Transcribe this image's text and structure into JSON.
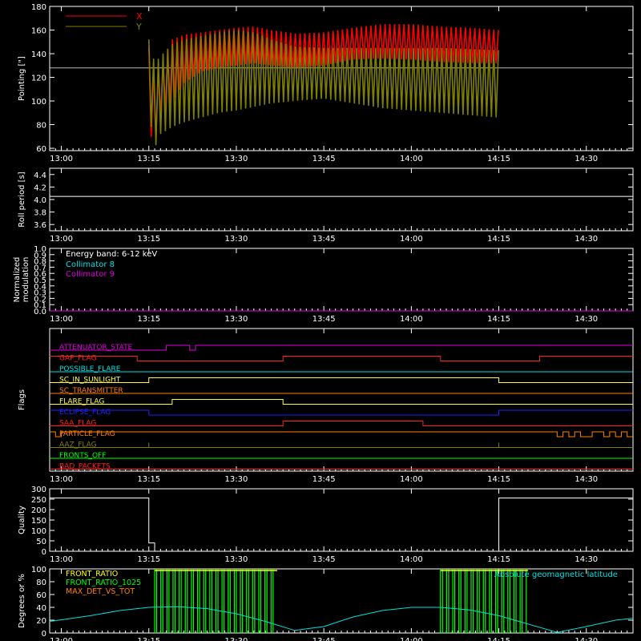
{
  "time_ticks": [
    "13:00",
    "13:15",
    "13:30",
    "13:45",
    "14:00",
    "14:15",
    "14:30"
  ],
  "chart_data": [
    {
      "type": "line",
      "ylabel": "Pointing [\"]",
      "ylim": [
        58,
        180
      ],
      "yticks": [
        60,
        80,
        100,
        120,
        140,
        160,
        180
      ],
      "x_axis": "time of day",
      "xlim": [
        "12:58",
        "14:38"
      ],
      "reference_line": 128,
      "legend_position": "top-left",
      "series": [
        {
          "name": "X",
          "color": "#ff0000",
          "x": [
            "13:15",
            "13:16",
            "13:17",
            "13:19",
            "13:21",
            "13:24",
            "13:27",
            "13:30",
            "13:33",
            "13:36",
            "13:40",
            "13:45",
            "13:50",
            "13:55",
            "14:00",
            "14:05",
            "14:10",
            "14:15"
          ],
          "y_max": [
            145,
            122,
            128,
            152,
            156,
            158,
            160,
            162,
            163,
            160,
            157,
            158,
            162,
            165,
            165,
            163,
            162,
            160
          ],
          "y_min": [
            75,
            62,
            88,
            100,
            115,
            125,
            128,
            130,
            132,
            130,
            128,
            130,
            135,
            136,
            135,
            133,
            132,
            132
          ]
        },
        {
          "name": "Y",
          "color": "#808000",
          "x": [
            "13:15",
            "13:16",
            "13:17",
            "13:19",
            "13:21",
            "13:24",
            "13:27",
            "13:30",
            "13:33",
            "13:36",
            "13:40",
            "13:45",
            "13:50",
            "13:55",
            "14:00",
            "14:05",
            "14:10",
            "14:15"
          ],
          "y_max": [
            152,
            132,
            138,
            148,
            152,
            155,
            158,
            160,
            158,
            152,
            146,
            145,
            145,
            145,
            145,
            145,
            144,
            143
          ],
          "y_min": [
            90,
            60,
            72,
            78,
            82,
            86,
            90,
            92,
            95,
            98,
            100,
            102,
            98,
            94,
            92,
            90,
            88,
            86
          ]
        }
      ]
    },
    {
      "type": "line",
      "ylabel": "Roll period [s]",
      "ylim": [
        3.5,
        4.5
      ],
      "yticks": [
        3.6,
        3.8,
        4.0,
        4.2,
        4.4
      ],
      "series": [
        {
          "x": [
            "12:58",
            "14:38"
          ],
          "y": [
            4.05,
            4.05
          ],
          "color": "#ffffff"
        }
      ]
    },
    {
      "type": "line",
      "ylabel": "Normalized modulation",
      "ylim": [
        0,
        1.0
      ],
      "yticks": [
        0.0,
        0.1,
        0.2,
        0.3,
        0.4,
        0.5,
        0.6,
        0.7,
        0.8,
        0.9,
        1.0
      ],
      "annotation": "Energy band: 6-12 keV",
      "series": [
        {
          "name": "Collimator 8",
          "color": "#00e0e0",
          "x": [
            "12:58",
            "14:38"
          ],
          "y": [
            0,
            0
          ]
        },
        {
          "name": "Collimator 9",
          "color": "#e000e0",
          "x": [
            "12:58",
            "14:38"
          ],
          "y": [
            0,
            0
          ]
        }
      ]
    },
    {
      "type": "line",
      "ylabel": "Flags",
      "flags": [
        {
          "name": "ATTENUATOR_STATE",
          "color": "#e000e0",
          "x": [
            "12:58",
            "13:18",
            "13:18",
            "13:22",
            "13:22",
            "13:23",
            "13:23",
            "14:38"
          ],
          "y": [
            0,
            0,
            1,
            1,
            0,
            0,
            1,
            1
          ]
        },
        {
          "name": "GAP_FLAG",
          "color": "#ff2020",
          "x": [
            "12:58",
            "13:13",
            "13:13",
            "13:38",
            "13:38",
            "14:05",
            "14:05",
            "14:22",
            "14:22",
            "14:38"
          ],
          "y": [
            1,
            1,
            0,
            0,
            1,
            1,
            0,
            0,
            1,
            1
          ]
        },
        {
          "name": "POSSIBLE_FLARE",
          "color": "#00e0e0",
          "x": [
            "12:58",
            "14:38"
          ],
          "y": [
            0,
            0
          ]
        },
        {
          "name": "SC_IN_SUNLIGHT",
          "color": "#ffff40",
          "x": [
            "12:58",
            "13:15",
            "13:15",
            "14:15",
            "14:15",
            "14:38"
          ],
          "y": [
            0,
            0,
            1,
            1,
            0,
            0
          ]
        },
        {
          "name": "SC_TRANSMITTER",
          "color": "#ff8000",
          "x": [
            "12:58",
            "14:38"
          ],
          "y": [
            0,
            0
          ]
        },
        {
          "name": "FLARE_FLAG",
          "color": "#ffff40",
          "x": [
            "12:58",
            "13:19",
            "13:19",
            "13:38",
            "13:38",
            "14:38"
          ],
          "y": [
            0,
            0,
            1,
            1,
            0,
            0
          ]
        },
        {
          "name": "ECLIPSE_FLAG",
          "color": "#2020ff",
          "x": [
            "12:58",
            "13:15",
            "13:15",
            "14:15",
            "14:15",
            "14:38"
          ],
          "y": [
            1,
            1,
            0,
            0,
            1,
            1
          ]
        },
        {
          "name": "SAA_FLAG",
          "color": "#ff2020",
          "x": [
            "12:58",
            "13:38",
            "13:38",
            "14:02",
            "14:02",
            "14:38"
          ],
          "y": [
            0,
            0,
            1,
            1,
            0,
            0
          ]
        },
        {
          "name": "PARTICLE_FLAG",
          "color": "#ff8000",
          "x": [
            "12:58",
            "12:59",
            "12:59",
            "13:00",
            "13:00",
            "14:25",
            "14:25",
            "14:26",
            "14:26",
            "14:27",
            "14:27",
            "14:28",
            "14:28",
            "14:29",
            "14:29",
            "14:31",
            "14:31",
            "14:33",
            "14:33",
            "14:34",
            "14:34",
            "14:35",
            "14:35",
            "14:36",
            "14:36",
            "14:37",
            "14:37",
            "14:38"
          ],
          "y": [
            1,
            1,
            0,
            0,
            1,
            1,
            0,
            0,
            1,
            1,
            0,
            0,
            1,
            1,
            0,
            0,
            1,
            1,
            0,
            0,
            1,
            1,
            0,
            0,
            1,
            1,
            0,
            0
          ]
        },
        {
          "name": "AAZ_FLAG",
          "color": "#808000",
          "x": [
            "12:58",
            "13:15",
            "13:15",
            "13:15",
            "13:15",
            "14:15",
            "14:15",
            "14:15",
            "14:15",
            "14:38"
          ],
          "y": [
            0,
            0,
            1,
            1,
            0,
            0,
            1,
            1,
            0,
            0
          ]
        },
        {
          "name": "FRONTS_OFF",
          "color": "#00ff00",
          "x": [
            "12:58",
            "14:38"
          ],
          "y": [
            0,
            0
          ]
        },
        {
          "name": "BAD_PACKETS",
          "color": "#ff2020",
          "x": [
            "12:58",
            "14:38"
          ],
          "y": [
            0,
            0
          ]
        }
      ]
    },
    {
      "type": "line",
      "ylabel": "Quality",
      "ylim": [
        0,
        300
      ],
      "yticks": [
        0,
        50,
        100,
        150,
        200,
        250,
        300
      ],
      "series": [
        {
          "color": "#ffffff",
          "x": [
            "12:58",
            "13:15",
            "13:15",
            "13:16",
            "13:16",
            "13:30",
            "13:30",
            "13:30",
            "13:30",
            "14:15",
            "14:15",
            "14:38"
          ],
          "y": [
            256,
            256,
            40,
            40,
            0,
            0,
            8,
            8,
            0,
            0,
            256,
            256
          ]
        }
      ]
    },
    {
      "type": "line",
      "ylabel": "Degrees or %",
      "ylim": [
        0,
        100
      ],
      "yticks": [
        0,
        20,
        40,
        60,
        80,
        100
      ],
      "series": [
        {
          "name": "FRONT_RATIO",
          "color": "#ffff00",
          "x": [
            "12:58",
            "14:38"
          ],
          "y": [
            0,
            0
          ]
        },
        {
          "name": "FRONT_RATIO_1025",
          "color": "#00ff00",
          "x": [
            "12:58",
            "14:38"
          ],
          "y": [
            0,
            0
          ]
        },
        {
          "name": "MAX_DET_VS_TOT",
          "color": "#ff8000",
          "x": [
            "12:58",
            "14:38"
          ],
          "y": [
            0,
            0
          ]
        },
        {
          "name": "Absolute geomagnetic latitude",
          "color": "#00e0e0",
          "x": [
            "12:58",
            "13:05",
            "13:10",
            "13:15",
            "13:20",
            "13:25",
            "13:30",
            "13:35",
            "13:40",
            "13:45",
            "13:50",
            "13:55",
            "14:00",
            "14:05",
            "14:10",
            "14:15",
            "14:20",
            "14:25",
            "14:30",
            "14:35",
            "14:38"
          ],
          "y": [
            18,
            27,
            35,
            40,
            41,
            38,
            30,
            18,
            4,
            10,
            25,
            35,
            40,
            40,
            36,
            27,
            14,
            1,
            10,
            20,
            23
          ]
        }
      ],
      "green_bands": [
        [
          "13:16",
          "13:37"
        ],
        [
          "14:05",
          "14:20"
        ]
      ]
    }
  ]
}
